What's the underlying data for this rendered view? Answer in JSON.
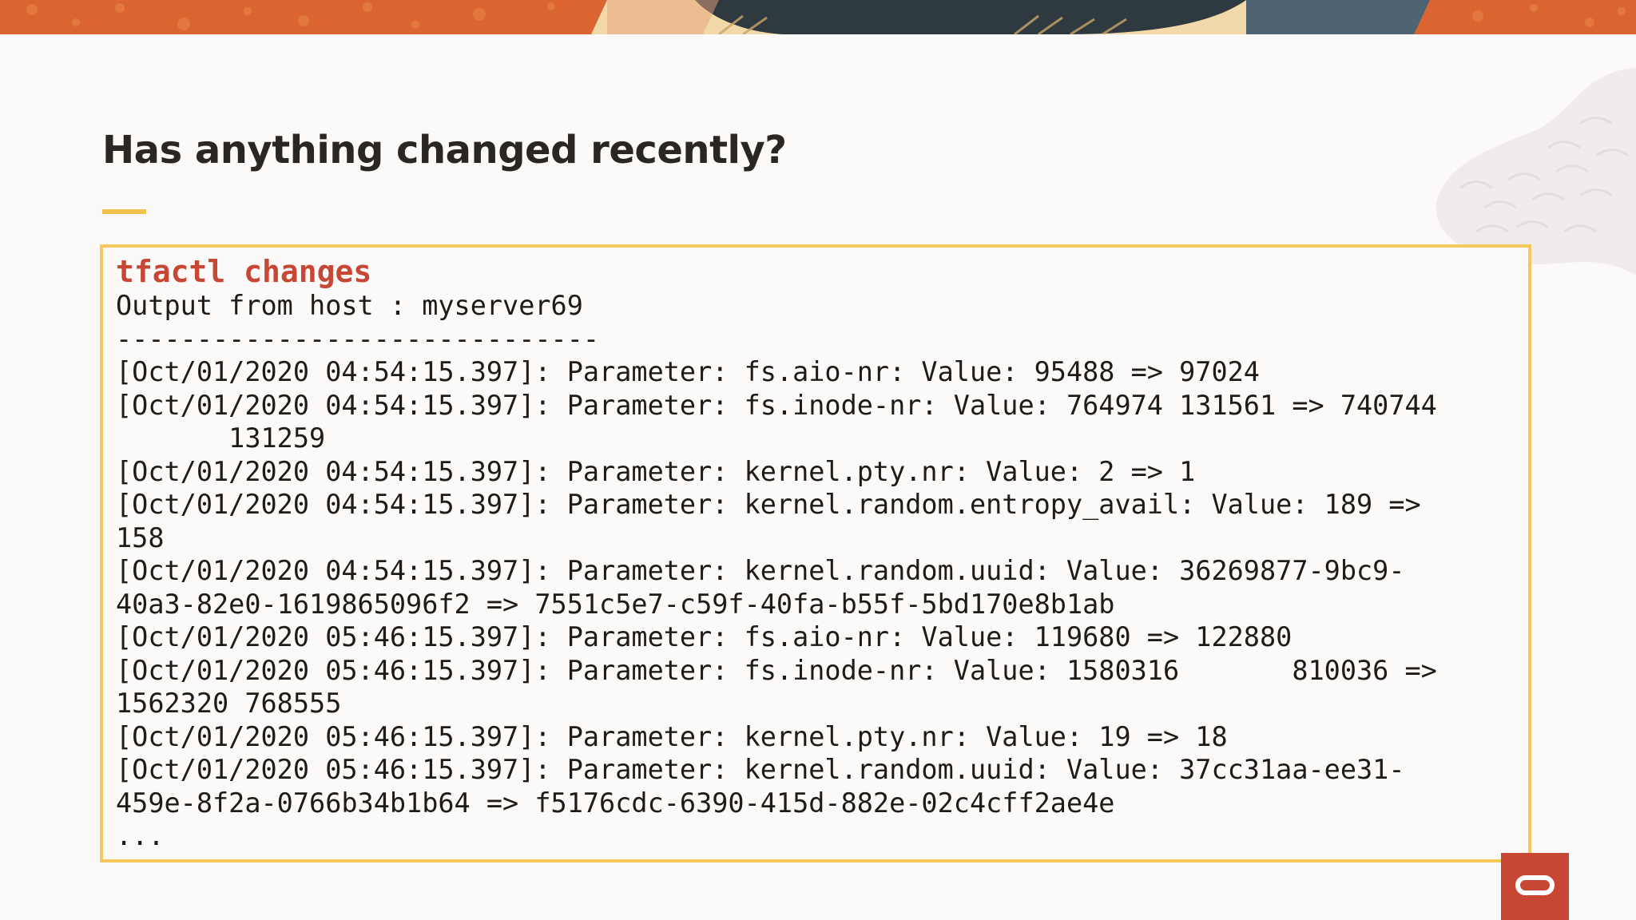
{
  "slide": {
    "title": "Has anything changed recently?"
  },
  "terminal": {
    "command": "tfactl changes",
    "lines": [
      "Output from host : myserver69",
      "------------------------------",
      "[Oct/01/2020 04:54:15.397]: Parameter: fs.aio-nr: Value: 95488 => 97024",
      "[Oct/01/2020 04:54:15.397]: Parameter: fs.inode-nr: Value: 764974 131561 => 740744",
      "       131259",
      "[Oct/01/2020 04:54:15.397]: Parameter: kernel.pty.nr: Value: 2 => 1",
      "[Oct/01/2020 04:54:15.397]: Parameter: kernel.random.entropy_avail: Value: 189 =>",
      "158",
      "[Oct/01/2020 04:54:15.397]: Parameter: kernel.random.uuid: Value: 36269877-9bc9-",
      "40a3-82e0-1619865096f2 => 7551c5e7-c59f-40fa-b55f-5bd170e8b1ab",
      "[Oct/01/2020 05:46:15.397]: Parameter: fs.aio-nr: Value: 119680 => 122880",
      "[Oct/01/2020 05:46:15.397]: Parameter: fs.inode-nr: Value: 1580316       810036 =>",
      "1562320 768555",
      "[Oct/01/2020 05:46:15.397]: Parameter: kernel.pty.nr: Value: 19 => 18",
      "[Oct/01/2020 05:46:15.397]: Parameter: kernel.random.uuid: Value: 37cc31aa-ee31-",
      "459e-8f2a-0766b34b1b64 => f5176cdc-6390-415d-882e-02c4cff2ae4e",
      "..."
    ]
  },
  "colors": {
    "command": "#c74634",
    "box_border": "#f5c85c",
    "accent": "#f2c14e",
    "brand": "#c74634"
  },
  "icons": {
    "brand_logo": "oracle-logo-icon"
  }
}
